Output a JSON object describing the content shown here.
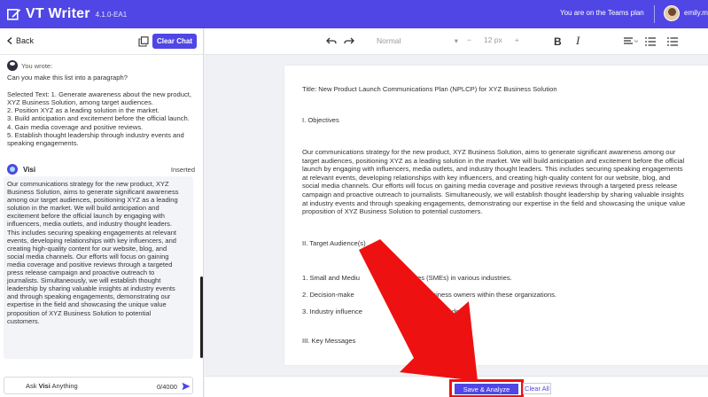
{
  "app": {
    "title": "VT Writer",
    "version": "4.1.0-EA1",
    "plan_text": "You are on the Teams plan",
    "user_name": "emily.mat"
  },
  "left_panel": {
    "back_label": "Back",
    "clear_chat_label": "Clear Chat",
    "you_wrote_label": "You wrote:",
    "user_message": [
      "Can you make this list into a paragraph?",
      "",
      "Selected Text: 1. Generate awareness about the new product,",
      "XYZ Business Solution, among target audiences.",
      "2. Position XYZ as a leading solution in the market.",
      "3. Build anticipation and excitement before the official launch.",
      "4. Gain media coverage and positive reviews.",
      "5. Establish thought leadership through industry events and",
      "speaking engagements."
    ],
    "assistant_name": "Visi",
    "inserted_label": "Inserted",
    "assistant_message": [
      "Our communications strategy for the new product, XYZ",
      "Business Solution, aims to generate significant awareness",
      "among our target audiences, positioning XYZ as a leading",
      "solution in the market. We will build anticipation and",
      "excitement before the official launch by engaging with",
      "influencers, media outlets, and industry thought leaders.",
      "This includes securing speaking engagements at relevant",
      "events, developing relationships with key influencers, and",
      "creating high-quality content for our website, blog, and",
      "social media channels. Our efforts will focus on gaining",
      "media coverage and positive reviews through a targeted",
      "press release campaign and proactive outreach to",
      "journalists. Simultaneously, we will establish thought",
      "leadership by sharing valuable insights at industry events",
      "and through speaking engagements, demonstrating our",
      "expertise in the field and showcasing the unique value",
      "proposition of XYZ Business Solution to potential",
      "customers."
    ],
    "ask_prefix": "Ask",
    "ask_name": "Visi",
    "ask_suffix": "Anything",
    "char_counter": "0/4000"
  },
  "toolbar": {
    "undo_icon": "undo-icon",
    "redo_icon": "redo-icon",
    "paragraph_style": "Normal",
    "minus_label": "−",
    "font_size": "12 px",
    "plus_label": "+",
    "bold_label": "B",
    "italic_label": "I"
  },
  "document": {
    "title": "Title: New Product Launch Communications Plan (NPLCP) for XYZ Business Solution",
    "section1": "I. Objectives",
    "paragraph": [
      "Our communications strategy for the new product, XYZ Business Solution, aims to generate significant awareness among our",
      "target audiences, positioning XYZ as a leading solution in the market. We will build anticipation and excitement before the official",
      "launch by engaging with influencers, media outlets, and industry thought leaders. This includes securing speaking engagements",
      "at relevant events, developing relationships with key influencers, and creating high-quality content for our website, blog, and",
      "social media channels. Our efforts will focus on gaining media coverage and positive reviews through a targeted press release",
      "campaign and proactive outreach to journalists. Simultaneously, we will establish thought leadership by sharing valuable insights",
      "at industry events and through speaking engagements, demonstrating our expertise in the field and showcasing the unique value",
      "proposition of XYZ Business Solution to potential customers."
    ],
    "section2": "II. Target Audience(s)",
    "audience1": "1. Small and Mediu                           rises (SMEs) in various industries.",
    "audience2": "2. Decision-make                               and business owners within these organizations.",
    "audience3": "3. Industry influence                           d thought leaders.",
    "section3": "III. Key Messages"
  },
  "bottom": {
    "save_label": "Save & Analyze",
    "clear_all_label": "Clear All"
  },
  "colors": {
    "accent": "#4f46e5",
    "highlight": "#e11111"
  }
}
